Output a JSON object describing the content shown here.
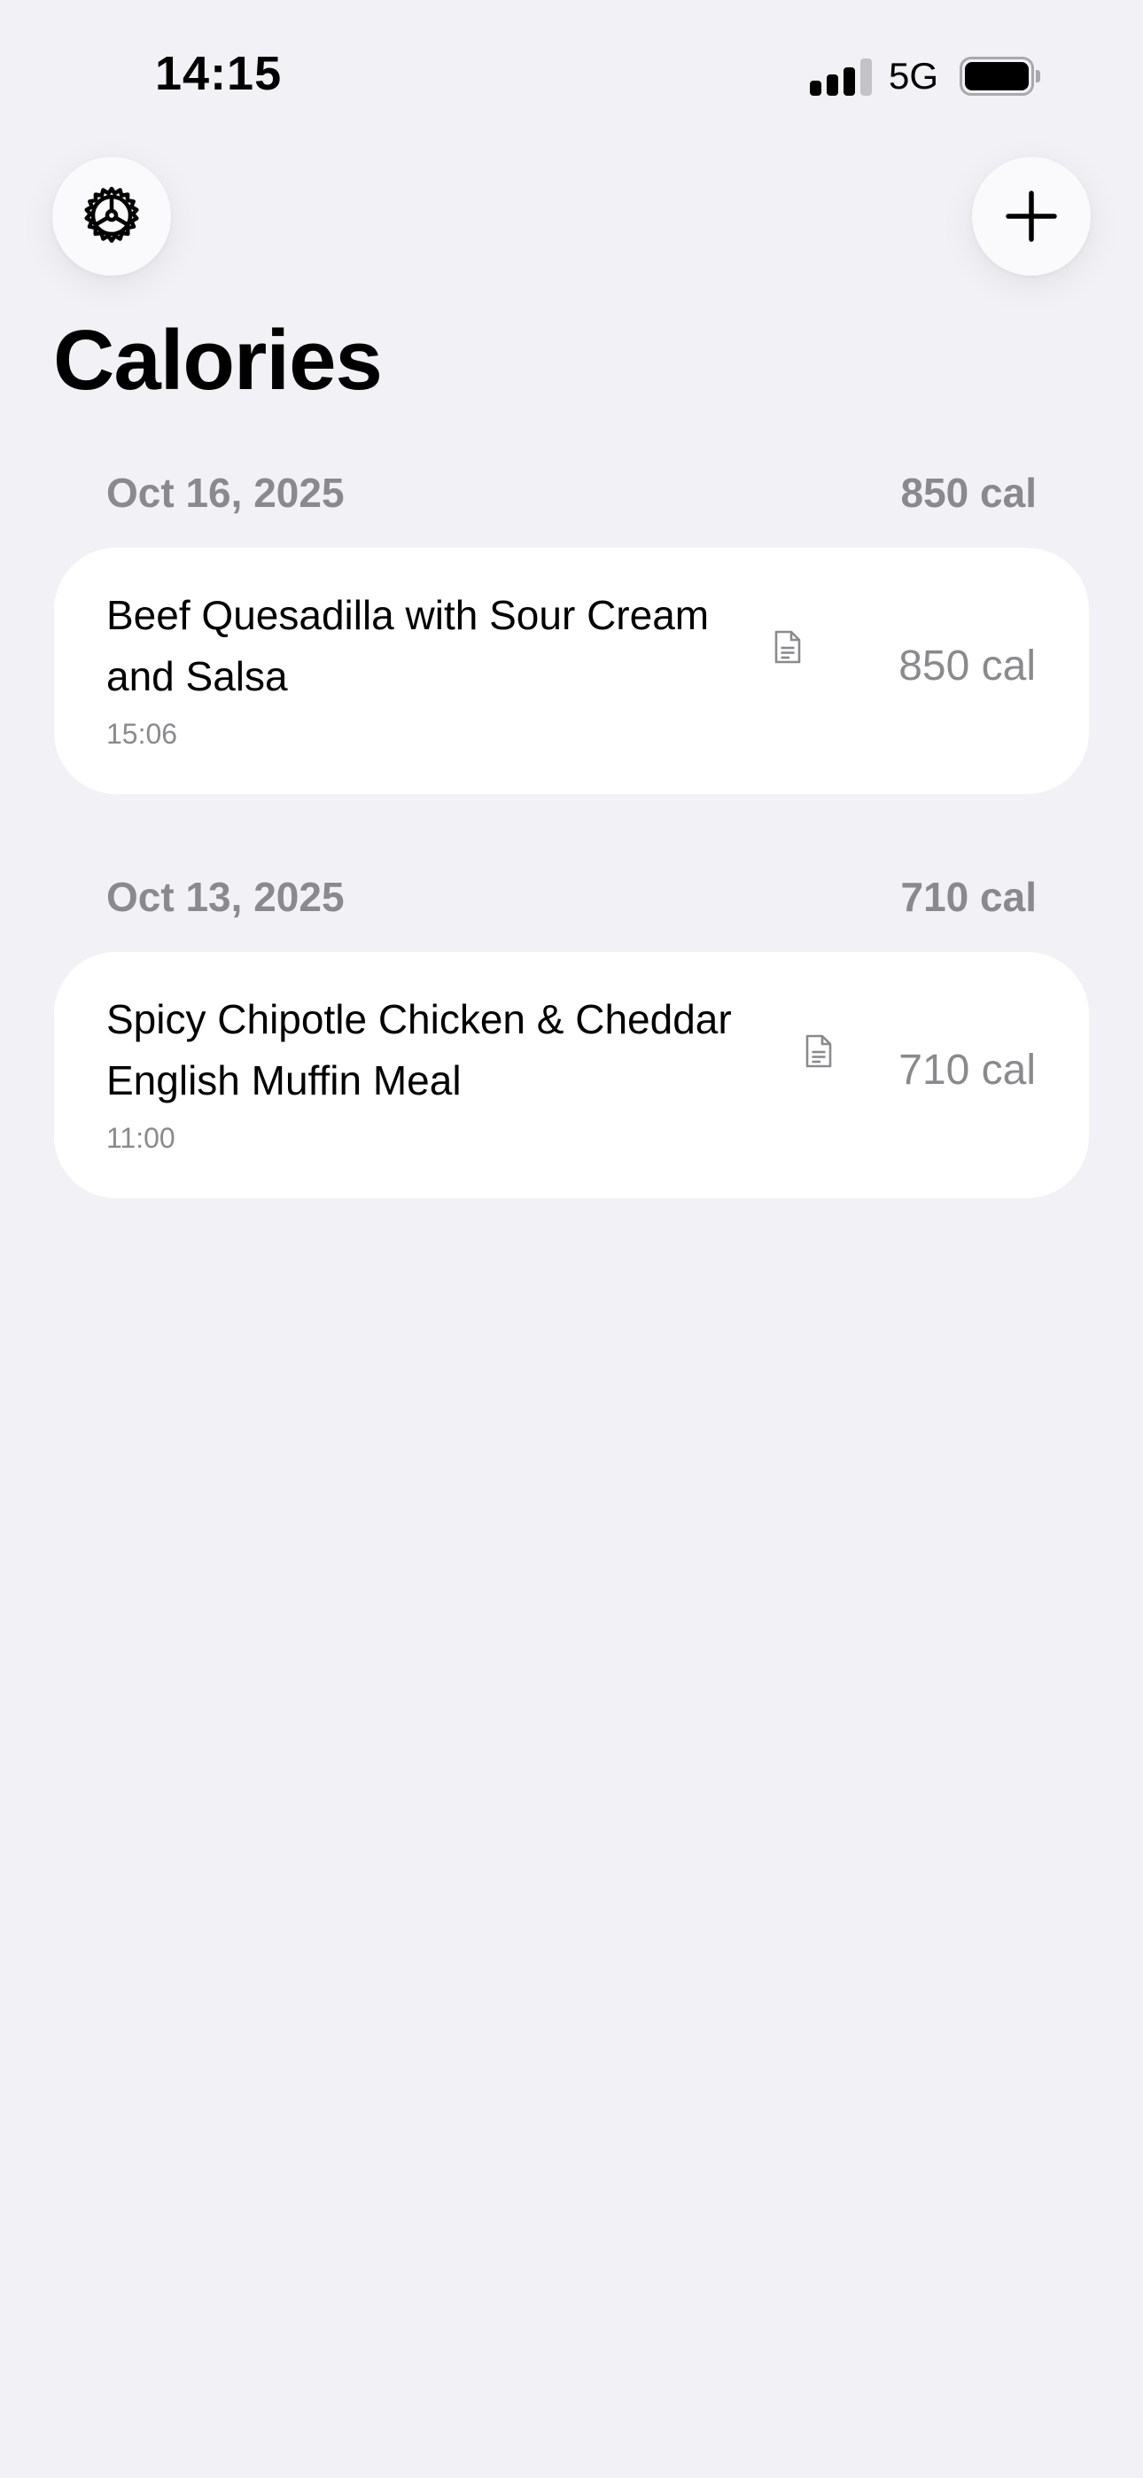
{
  "status_bar": {
    "time": "14:15",
    "network": "5G",
    "signal_bars_active": 3,
    "signal_bars_total": 4,
    "battery_level": 0.9
  },
  "toolbar": {
    "settings_icon": "gear-icon",
    "add_icon": "plus-icon"
  },
  "page": {
    "title": "Calories"
  },
  "sections": [
    {
      "date": "Oct 16, 2025",
      "total": "850 cal",
      "entries": [
        {
          "name": "Beef Quesadilla with Sour Cream and Salsa",
          "time": "15:06",
          "calories": "850 cal",
          "icon": "document-icon"
        }
      ]
    },
    {
      "date": "Oct 13, 2025",
      "total": "710 cal",
      "entries": [
        {
          "name": "Spicy Chipotle Chicken & Cheddar English Muffin Meal",
          "time": "11:00",
          "calories": "710 cal",
          "icon": "document-icon"
        }
      ]
    }
  ],
  "colors": {
    "background": "#f1f1f6",
    "card": "#ffffff",
    "secondary_text": "#8a8a8e",
    "primary_text": "#000000"
  }
}
